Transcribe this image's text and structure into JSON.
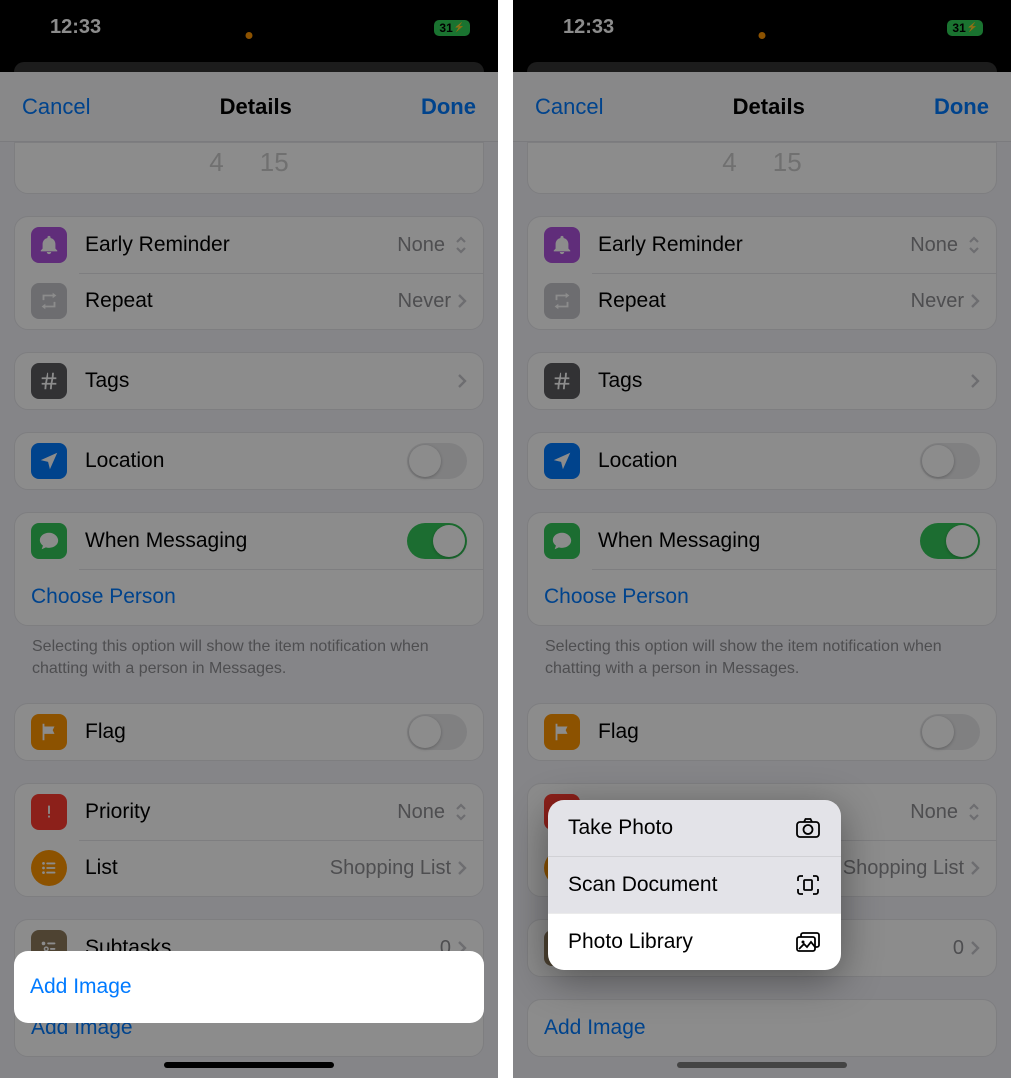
{
  "status": {
    "time": "12:33",
    "battery": "31"
  },
  "nav": {
    "cancel": "Cancel",
    "title": "Details",
    "done": "Done"
  },
  "picker": {
    "a": "4",
    "b": "15"
  },
  "rows": {
    "earlyReminder": {
      "label": "Early Reminder",
      "value": "None"
    },
    "repeat": {
      "label": "Repeat",
      "value": "Never"
    },
    "tags": {
      "label": "Tags"
    },
    "location": {
      "label": "Location"
    },
    "messaging": {
      "label": "When Messaging"
    },
    "choosePerson": "Choose Person",
    "footer": "Selecting this option will show the item notification when chatting with a person in Messages.",
    "flag": {
      "label": "Flag"
    },
    "priority": {
      "label": "Priority",
      "value": "None"
    },
    "list": {
      "label": "List",
      "value": "Shopping List"
    },
    "subtasks": {
      "label": "Subtasks",
      "value": "0"
    },
    "addImage": "Add Image"
  },
  "menu": {
    "takePhoto": "Take Photo",
    "scanDocument": "Scan Document",
    "photoLibrary": "Photo Library"
  }
}
